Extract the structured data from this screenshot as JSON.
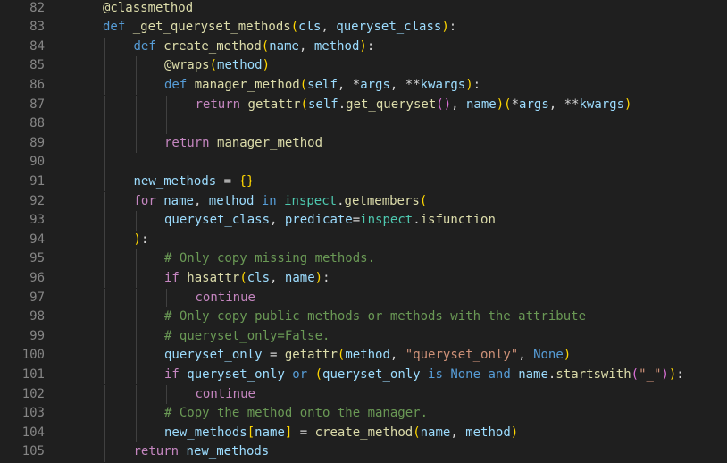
{
  "editor": {
    "language": "python",
    "theme_colors": {
      "background": "#1f1f1f",
      "line_number": "#858585",
      "keyword": "#569cd6",
      "control": "#c586c0",
      "function": "#dcdcaa",
      "variable": "#9cdcfe",
      "string": "#ce9178",
      "comment": "#6a9955",
      "builtin": "#4ec9b0",
      "bracket_level_1": "#ffd700",
      "bracket_level_2": "#da70d6",
      "bracket_level_3": "#179fff"
    },
    "lines": [
      {
        "num": "82",
        "indent": 0,
        "tokens": [
          {
            "t": "@classmethod",
            "c": "decorator"
          }
        ]
      },
      {
        "num": "83",
        "indent": 0,
        "tokens": [
          {
            "t": "def ",
            "c": "keyword"
          },
          {
            "t": "_get_queryset_methods",
            "c": "function"
          },
          {
            "t": "(",
            "c": "bracket1"
          },
          {
            "t": "cls",
            "c": "variable"
          },
          {
            "t": ", ",
            "c": "default"
          },
          {
            "t": "queryset_class",
            "c": "variable"
          },
          {
            "t": ")",
            "c": "bracket1"
          },
          {
            "t": ":",
            "c": "default"
          }
        ]
      },
      {
        "num": "84",
        "indent": 1,
        "tokens": [
          {
            "t": "def ",
            "c": "keyword"
          },
          {
            "t": "create_method",
            "c": "function"
          },
          {
            "t": "(",
            "c": "bracket1"
          },
          {
            "t": "name",
            "c": "variable"
          },
          {
            "t": ", ",
            "c": "default"
          },
          {
            "t": "method",
            "c": "variable"
          },
          {
            "t": ")",
            "c": "bracket1"
          },
          {
            "t": ":",
            "c": "default"
          }
        ]
      },
      {
        "num": "85",
        "indent": 2,
        "tokens": [
          {
            "t": "@wraps",
            "c": "decorator"
          },
          {
            "t": "(",
            "c": "bracket1"
          },
          {
            "t": "method",
            "c": "variable"
          },
          {
            "t": ")",
            "c": "bracket1"
          }
        ]
      },
      {
        "num": "86",
        "indent": 2,
        "tokens": [
          {
            "t": "def ",
            "c": "keyword"
          },
          {
            "t": "manager_method",
            "c": "function"
          },
          {
            "t": "(",
            "c": "bracket1"
          },
          {
            "t": "self",
            "c": "variable"
          },
          {
            "t": ", *",
            "c": "default"
          },
          {
            "t": "args",
            "c": "variable"
          },
          {
            "t": ", **",
            "c": "default"
          },
          {
            "t": "kwargs",
            "c": "variable"
          },
          {
            "t": ")",
            "c": "bracket1"
          },
          {
            "t": ":",
            "c": "default"
          }
        ]
      },
      {
        "num": "87",
        "indent": 3,
        "tokens": [
          {
            "t": "return ",
            "c": "control"
          },
          {
            "t": "getattr",
            "c": "function"
          },
          {
            "t": "(",
            "c": "bracket1"
          },
          {
            "t": "self",
            "c": "variable"
          },
          {
            "t": ".",
            "c": "default"
          },
          {
            "t": "get_queryset",
            "c": "function"
          },
          {
            "t": "()",
            "c": "bracket2"
          },
          {
            "t": ", ",
            "c": "default"
          },
          {
            "t": "name",
            "c": "variable"
          },
          {
            "t": ")",
            "c": "bracket1"
          },
          {
            "t": "(",
            "c": "bracket1"
          },
          {
            "t": "*",
            "c": "default"
          },
          {
            "t": "args",
            "c": "variable"
          },
          {
            "t": ", **",
            "c": "default"
          },
          {
            "t": "kwargs",
            "c": "variable"
          },
          {
            "t": ")",
            "c": "bracket1"
          }
        ]
      },
      {
        "num": "88",
        "indent": 3,
        "tokens": []
      },
      {
        "num": "89",
        "indent": 2,
        "tokens": [
          {
            "t": "return ",
            "c": "control"
          },
          {
            "t": "manager_method",
            "c": "function"
          }
        ]
      },
      {
        "num": "90",
        "indent": 1,
        "tokens": []
      },
      {
        "num": "91",
        "indent": 1,
        "tokens": [
          {
            "t": "new_methods",
            "c": "variable"
          },
          {
            "t": " = ",
            "c": "default"
          },
          {
            "t": "{}",
            "c": "bracket1"
          }
        ]
      },
      {
        "num": "92",
        "indent": 1,
        "tokens": [
          {
            "t": "for ",
            "c": "control"
          },
          {
            "t": "name",
            "c": "variable"
          },
          {
            "t": ", ",
            "c": "default"
          },
          {
            "t": "method",
            "c": "variable"
          },
          {
            "t": " in ",
            "c": "keyword"
          },
          {
            "t": "inspect",
            "c": "builtin"
          },
          {
            "t": ".",
            "c": "default"
          },
          {
            "t": "getmembers",
            "c": "function"
          },
          {
            "t": "(",
            "c": "bracket1"
          }
        ]
      },
      {
        "num": "93",
        "indent": 2,
        "tokens": [
          {
            "t": "queryset_class",
            "c": "variable"
          },
          {
            "t": ", ",
            "c": "default"
          },
          {
            "t": "predicate",
            "c": "variable"
          },
          {
            "t": "=",
            "c": "default"
          },
          {
            "t": "inspect",
            "c": "builtin"
          },
          {
            "t": ".",
            "c": "default"
          },
          {
            "t": "isfunction",
            "c": "function"
          }
        ]
      },
      {
        "num": "94",
        "indent": 1,
        "tokens": [
          {
            "t": ")",
            "c": "bracket1"
          },
          {
            "t": ":",
            "c": "default"
          }
        ]
      },
      {
        "num": "95",
        "indent": 2,
        "tokens": [
          {
            "t": "# Only copy missing methods.",
            "c": "comment"
          }
        ]
      },
      {
        "num": "96",
        "indent": 2,
        "tokens": [
          {
            "t": "if ",
            "c": "control"
          },
          {
            "t": "hasattr",
            "c": "function"
          },
          {
            "t": "(",
            "c": "bracket1"
          },
          {
            "t": "cls",
            "c": "variable"
          },
          {
            "t": ", ",
            "c": "default"
          },
          {
            "t": "name",
            "c": "variable"
          },
          {
            "t": ")",
            "c": "bracket1"
          },
          {
            "t": ":",
            "c": "default"
          }
        ]
      },
      {
        "num": "97",
        "indent": 3,
        "tokens": [
          {
            "t": "continue",
            "c": "control"
          }
        ]
      },
      {
        "num": "98",
        "indent": 2,
        "tokens": [
          {
            "t": "# Only copy public methods or methods with the attribute",
            "c": "comment"
          }
        ]
      },
      {
        "num": "99",
        "indent": 2,
        "tokens": [
          {
            "t": "# queryset_only=False.",
            "c": "comment"
          }
        ]
      },
      {
        "num": "100",
        "indent": 2,
        "tokens": [
          {
            "t": "queryset_only",
            "c": "variable"
          },
          {
            "t": " = ",
            "c": "default"
          },
          {
            "t": "getattr",
            "c": "function"
          },
          {
            "t": "(",
            "c": "bracket1"
          },
          {
            "t": "method",
            "c": "variable"
          },
          {
            "t": ", ",
            "c": "default"
          },
          {
            "t": "\"queryset_only\"",
            "c": "string"
          },
          {
            "t": ", ",
            "c": "default"
          },
          {
            "t": "None",
            "c": "constant"
          },
          {
            "t": ")",
            "c": "bracket1"
          }
        ]
      },
      {
        "num": "101",
        "indent": 2,
        "tokens": [
          {
            "t": "if ",
            "c": "control"
          },
          {
            "t": "queryset_only",
            "c": "variable"
          },
          {
            "t": " or ",
            "c": "keyword"
          },
          {
            "t": "(",
            "c": "bracket1"
          },
          {
            "t": "queryset_only",
            "c": "variable"
          },
          {
            "t": " is ",
            "c": "keyword"
          },
          {
            "t": "None",
            "c": "constant"
          },
          {
            "t": " and ",
            "c": "keyword"
          },
          {
            "t": "name",
            "c": "variable"
          },
          {
            "t": ".",
            "c": "default"
          },
          {
            "t": "startswith",
            "c": "function"
          },
          {
            "t": "(",
            "c": "bracket2"
          },
          {
            "t": "\"_\"",
            "c": "string"
          },
          {
            "t": ")",
            "c": "bracket2"
          },
          {
            "t": ")",
            "c": "bracket1"
          },
          {
            "t": ":",
            "c": "default"
          }
        ]
      },
      {
        "num": "102",
        "indent": 3,
        "tokens": [
          {
            "t": "continue",
            "c": "control"
          }
        ]
      },
      {
        "num": "103",
        "indent": 2,
        "tokens": [
          {
            "t": "# Copy the method onto the manager.",
            "c": "comment"
          }
        ]
      },
      {
        "num": "104",
        "indent": 2,
        "tokens": [
          {
            "t": "new_methods",
            "c": "variable"
          },
          {
            "t": "[",
            "c": "bracket1"
          },
          {
            "t": "name",
            "c": "variable"
          },
          {
            "t": "]",
            "c": "bracket1"
          },
          {
            "t": " = ",
            "c": "default"
          },
          {
            "t": "create_method",
            "c": "function"
          },
          {
            "t": "(",
            "c": "bracket1"
          },
          {
            "t": "name",
            "c": "variable"
          },
          {
            "t": ", ",
            "c": "default"
          },
          {
            "t": "method",
            "c": "variable"
          },
          {
            "t": ")",
            "c": "bracket1"
          }
        ]
      },
      {
        "num": "105",
        "indent": 1,
        "tokens": [
          {
            "t": "return ",
            "c": "control"
          },
          {
            "t": "new_methods",
            "c": "variable"
          }
        ]
      }
    ]
  }
}
